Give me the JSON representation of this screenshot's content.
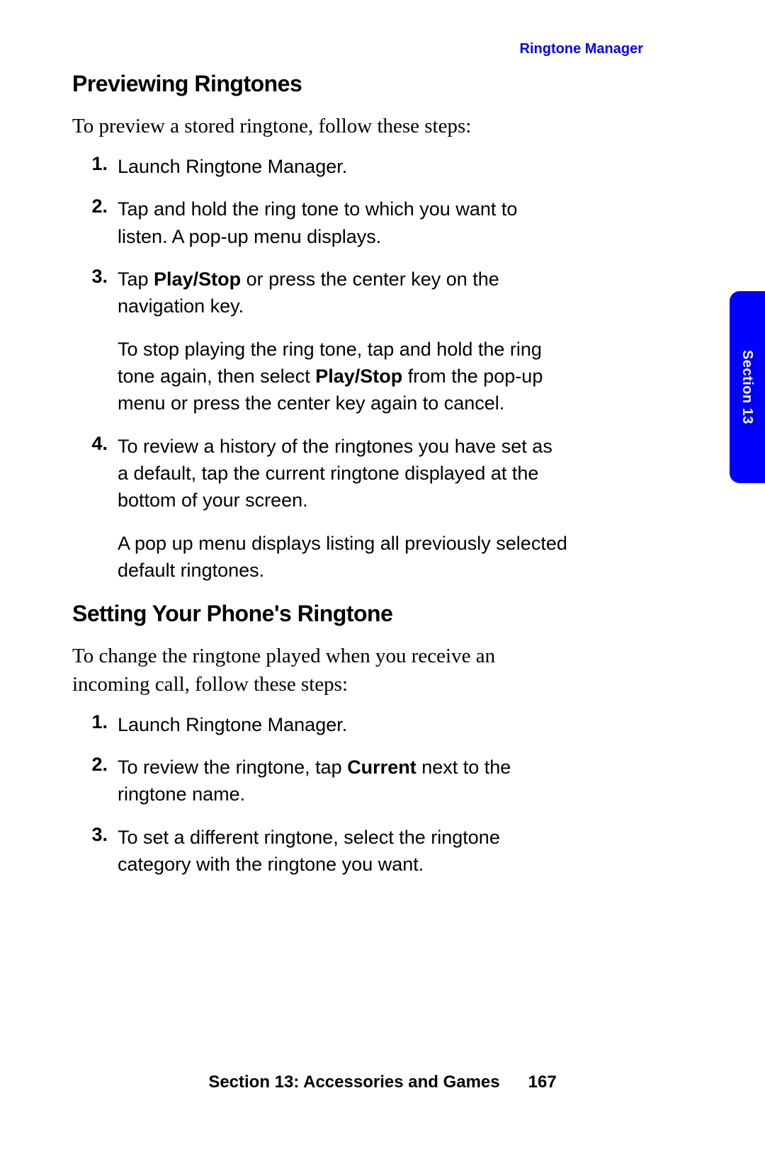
{
  "header": {
    "running": "Ringtone Manager"
  },
  "tab": {
    "label": "Section 13"
  },
  "footer": {
    "section": "Section 13: Accessories and Games",
    "page": "167"
  },
  "sections": [
    {
      "heading": "Previewing Ringtones",
      "intro": "To preview a stored ringtone, follow these steps:",
      "steps": [
        {
          "num": "1.",
          "paras": [
            {
              "runs": [
                {
                  "t": "Launch Ringtone Manager."
                }
              ]
            }
          ]
        },
        {
          "num": "2.",
          "paras": [
            {
              "runs": [
                {
                  "t": "Tap and hold the ring tone to which you want to listen. A pop-up menu displays."
                }
              ]
            }
          ]
        },
        {
          "num": "3.",
          "paras": [
            {
              "runs": [
                {
                  "t": "Tap "
                },
                {
                  "t": "Play/Stop",
                  "b": true
                },
                {
                  "t": " or press the center key on the navigation key."
                }
              ]
            },
            {
              "runs": [
                {
                  "t": "To stop playing the ring tone, tap and hold the ring tone again, then select "
                },
                {
                  "t": "Play/Stop",
                  "b": true
                },
                {
                  "t": " from the pop-up menu or press the center key again to cancel."
                }
              ]
            }
          ]
        },
        {
          "num": "4.",
          "paras": [
            {
              "runs": [
                {
                  "t": "To review a history of the ringtones you have set as a default, tap the current ringtone displayed at the bottom of your screen."
                }
              ]
            },
            {
              "runs": [
                {
                  "t": "A pop up menu displays listing all previously selected default ringtones."
                }
              ]
            }
          ]
        }
      ]
    },
    {
      "heading": "Setting Your Phone's Ringtone",
      "intro": "To change the ringtone played when you receive an incoming call, follow these steps:",
      "steps": [
        {
          "num": "1.",
          "paras": [
            {
              "runs": [
                {
                  "t": "Launch Ringtone Manager."
                }
              ]
            }
          ]
        },
        {
          "num": "2.",
          "paras": [
            {
              "runs": [
                {
                  "t": "To review the ringtone, tap "
                },
                {
                  "t": "Current",
                  "b": true
                },
                {
                  "t": " next to the ringtone name."
                }
              ]
            }
          ]
        },
        {
          "num": "3.",
          "paras": [
            {
              "runs": [
                {
                  "t": "To set a different ringtone, select the ringtone category with the ringtone you want."
                }
              ]
            }
          ]
        }
      ]
    }
  ]
}
